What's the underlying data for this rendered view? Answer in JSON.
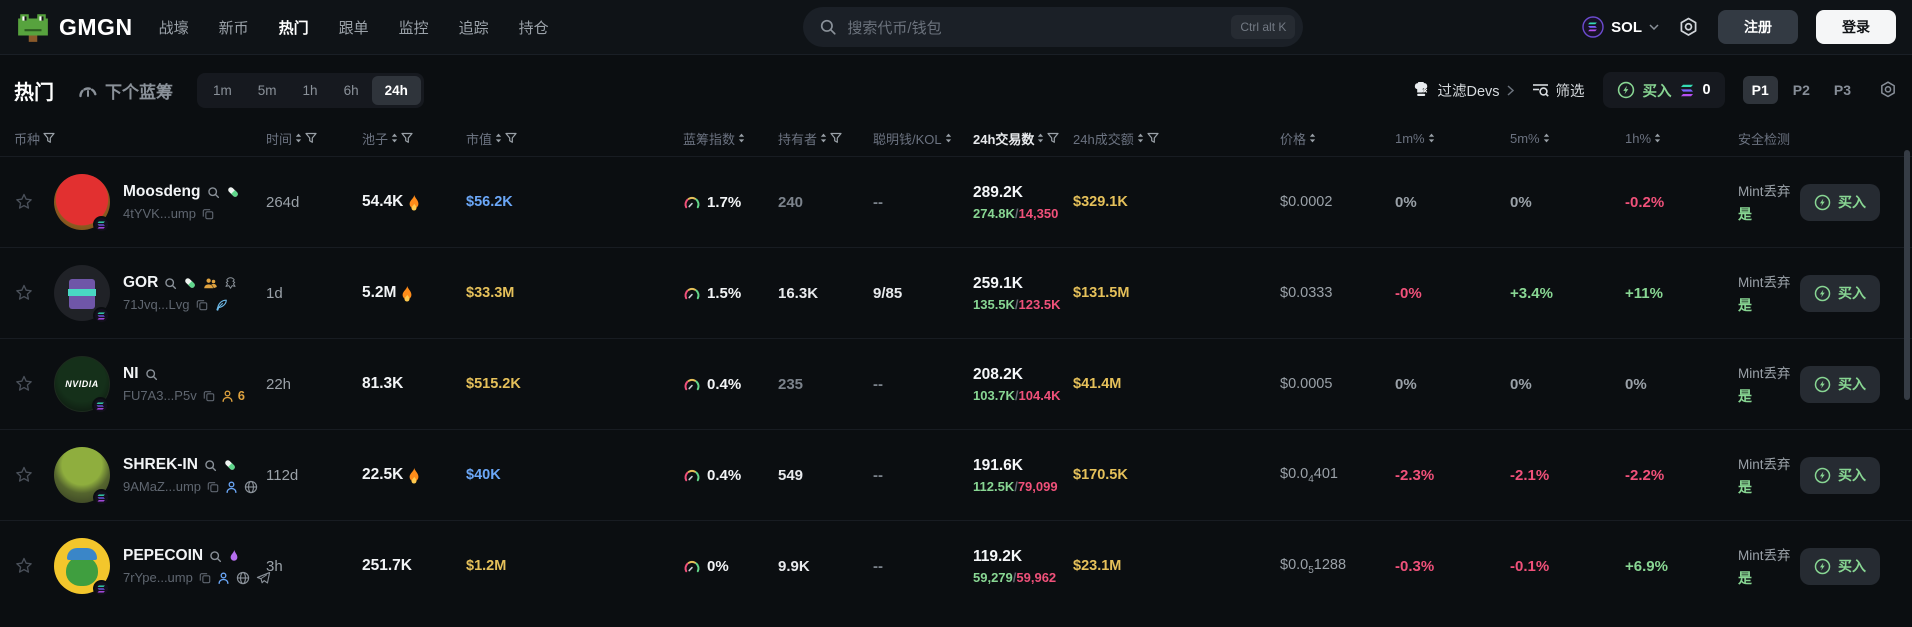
{
  "colors": {
    "accent_green": "#88d693",
    "down_red": "#f0517a",
    "volume_gold": "#e5c05a",
    "mcap_blue": "#6ba7f7"
  },
  "topbar": {
    "logo_text": "GMGN",
    "nav": [
      {
        "key": "trench",
        "label": "战壕",
        "active": false
      },
      {
        "key": "new",
        "label": "新币",
        "active": false
      },
      {
        "key": "trending",
        "label": "热门",
        "active": true
      },
      {
        "key": "copytrade",
        "label": "跟单",
        "active": false
      },
      {
        "key": "monitor",
        "label": "监控",
        "active": false
      },
      {
        "key": "track",
        "label": "追踪",
        "active": false
      },
      {
        "key": "holdings",
        "label": "持仓",
        "active": false
      }
    ],
    "search": {
      "placeholder": "搜索代币/钱包",
      "shortcut": "Ctrl alt K",
      "icon": "search-icon"
    },
    "chain_label": "SOL",
    "chain_icon": "solana-icon",
    "settings_icon": "gear-icon",
    "signup_label": "注册",
    "login_label": "登录"
  },
  "filterbar": {
    "title": "热门",
    "next_bluechip_label": "下个蓝筹",
    "next_bluechip_icon": "gauge-icon",
    "timeframes": [
      "1m",
      "5m",
      "1h",
      "6h",
      "24h"
    ],
    "active_timeframe": "24h",
    "filter_devs_label": "过滤Devs",
    "filter_devs_icon": "chef-hat-x-icon",
    "screen_label": "筛选",
    "screen_icon": "filter-search-icon",
    "buy_label": "买入",
    "buy_icon": "lightning-circle-icon",
    "buy_chain_icon": "solana-bars-icon",
    "buy_amount": "0",
    "presets": [
      "P1",
      "P2",
      "P3"
    ],
    "active_preset": "P1",
    "gear_icon": "gear-icon"
  },
  "table": {
    "headers": [
      {
        "key": "token",
        "label": "币种",
        "sort": false,
        "funnel": true,
        "active": false,
        "span2": true
      },
      {
        "key": "age",
        "label": "时间",
        "sort": true,
        "funnel": true,
        "active": false
      },
      {
        "key": "pool",
        "label": "池子",
        "sort": true,
        "funnel": true,
        "active": false
      },
      {
        "key": "mcap",
        "label": "市值",
        "sort": true,
        "funnel": true,
        "active": false
      },
      {
        "key": "bluechip",
        "label": "蓝筹指数",
        "sort": true,
        "funnel": false,
        "active": false
      },
      {
        "key": "holders",
        "label": "持有者",
        "sort": true,
        "funnel": true,
        "active": false
      },
      {
        "key": "smart",
        "label": "聪明钱/KOL",
        "sort": true,
        "funnel": false,
        "active": false
      },
      {
        "key": "tx",
        "label": "24h交易数",
        "sort": true,
        "funnel": true,
        "active": true
      },
      {
        "key": "volume",
        "label": "24h成交额",
        "sort": true,
        "funnel": true,
        "active": false
      },
      {
        "key": "price",
        "label": "价格",
        "sort": true,
        "funnel": false,
        "active": false
      },
      {
        "key": "m1",
        "label": "1m%",
        "sort": true,
        "funnel": false,
        "active": false
      },
      {
        "key": "m5",
        "label": "5m%",
        "sort": true,
        "funnel": false,
        "active": false
      },
      {
        "key": "h1",
        "label": "1h%",
        "sort": true,
        "funnel": false,
        "active": false
      },
      {
        "key": "security",
        "label": "安全检测",
        "sort": false,
        "funnel": false,
        "active": false
      }
    ],
    "rows": [
      {
        "name": "Moosdeng",
        "avatar": "moosdeng",
        "avatar_text": "",
        "name_icons": [
          "search-icon",
          "pill-icon"
        ],
        "address": "4tYVK...ump",
        "address_icons": [
          "copy-icon"
        ],
        "age": "264d",
        "pool": "54.4K",
        "pool_fire": true,
        "mcap": "$56.2K",
        "mcap_tone": "blue",
        "bluechip": "1.7%",
        "holders": "240",
        "holders_tone": "muted",
        "smart": "--",
        "smart_tone": "muted",
        "tx": "289.2K",
        "tx_buys": "274.8K",
        "tx_sells": "14,350",
        "volume": "$329.1K",
        "price": {
          "pre": "$0.0002",
          "sub": "",
          "post": ""
        },
        "chg_1m": {
          "text": "0%",
          "tone": "flat"
        },
        "chg_5m": {
          "text": "0%",
          "tone": "flat"
        },
        "chg_1h": {
          "text": "-0.2%",
          "tone": "down"
        },
        "security_label": "Mint丢弃",
        "security_value": "是",
        "buy_label": "买入"
      },
      {
        "name": "GOR",
        "avatar": "gor",
        "avatar_text": "",
        "name_icons": [
          "search-icon",
          "pill-icon",
          "community-icon",
          "dexscreener-icon"
        ],
        "address": "71Jvq...Lvg",
        "address_icons": [
          "copy-icon",
          "feather-icon"
        ],
        "age": "1d",
        "pool": "5.2M",
        "pool_fire": true,
        "mcap": "$33.3M",
        "mcap_tone": "gold",
        "bluechip": "1.5%",
        "holders": "16.3K",
        "holders_tone": "white",
        "smart": "9/85",
        "smart_tone": "white",
        "tx": "259.1K",
        "tx_buys": "135.5K",
        "tx_sells": "123.5K",
        "volume": "$131.5M",
        "price": {
          "pre": "$0.0333",
          "sub": "",
          "post": ""
        },
        "chg_1m": {
          "text": "-0%",
          "tone": "down"
        },
        "chg_5m": {
          "text": "+3.4%",
          "tone": "up"
        },
        "chg_1h": {
          "text": "+11%",
          "tone": "up"
        },
        "security_label": "Mint丢弃",
        "security_value": "是",
        "buy_label": "买入"
      },
      {
        "name": "NI",
        "avatar": "ni",
        "avatar_text": "NVIDIA",
        "name_icons": [
          "search-icon"
        ],
        "address": "FU7A3...P5v",
        "address_icons": [
          "copy-icon",
          "person-orange-icon"
        ],
        "address_count": "6",
        "age": "22h",
        "pool": "81.3K",
        "pool_fire": false,
        "mcap": "$515.2K",
        "mcap_tone": "gold",
        "bluechip": "0.4%",
        "holders": "235",
        "holders_tone": "muted",
        "smart": "--",
        "smart_tone": "muted",
        "tx": "208.2K",
        "tx_buys": "103.7K",
        "tx_sells": "104.4K",
        "volume": "$41.4M",
        "price": {
          "pre": "$0.0005",
          "sub": "",
          "post": ""
        },
        "chg_1m": {
          "text": "0%",
          "tone": "flat"
        },
        "chg_5m": {
          "text": "0%",
          "tone": "flat"
        },
        "chg_1h": {
          "text": "0%",
          "tone": "flat"
        },
        "security_label": "Mint丢弃",
        "security_value": "是",
        "buy_label": "买入"
      },
      {
        "name": "SHREK-IN",
        "avatar": "shrek",
        "avatar_text": "",
        "name_icons": [
          "search-icon",
          "pill-icon"
        ],
        "address": "9AMaZ...ump",
        "address_icons": [
          "copy-icon",
          "person-blue-icon",
          "globe-icon"
        ],
        "age": "112d",
        "pool": "22.5K",
        "pool_fire": true,
        "mcap": "$40K",
        "mcap_tone": "blue",
        "bluechip": "0.4%",
        "holders": "549",
        "holders_tone": "white",
        "smart": "--",
        "smart_tone": "muted",
        "tx": "191.6K",
        "tx_buys": "112.5K",
        "tx_sells": "79,099",
        "volume": "$170.5K",
        "price": {
          "pre": "$0.0",
          "sub": "4",
          "post": "401"
        },
        "chg_1m": {
          "text": "-2.3%",
          "tone": "down"
        },
        "chg_5m": {
          "text": "-2.1%",
          "tone": "down"
        },
        "chg_1h": {
          "text": "-2.2%",
          "tone": "down"
        },
        "security_label": "Mint丢弃",
        "security_value": "是",
        "buy_label": "买入"
      },
      {
        "name": "PEPECOIN",
        "avatar": "pepe",
        "avatar_text": "",
        "name_icons": [
          "search-icon",
          "flame-icon"
        ],
        "address": "7rYpe...ump",
        "address_icons": [
          "copy-icon",
          "person-blue-icon",
          "globe-icon",
          "telegram-icon"
        ],
        "age": "3h",
        "pool": "251.7K",
        "pool_fire": false,
        "mcap": "$1.2M",
        "mcap_tone": "gold",
        "bluechip": "0%",
        "holders": "9.9K",
        "holders_tone": "white",
        "smart": "--",
        "smart_tone": "muted",
        "tx": "119.2K",
        "tx_buys": "59,279",
        "tx_sells": "59,962",
        "volume": "$23.1M",
        "price": {
          "pre": "$0.0",
          "sub": "5",
          "post": "1288"
        },
        "chg_1m": {
          "text": "-0.3%",
          "tone": "down"
        },
        "chg_5m": {
          "text": "-0.1%",
          "tone": "down"
        },
        "chg_1h": {
          "text": "+6.9%",
          "tone": "up"
        },
        "security_label": "Mint丢弃",
        "security_value": "是",
        "buy_label": "买入"
      }
    ]
  }
}
